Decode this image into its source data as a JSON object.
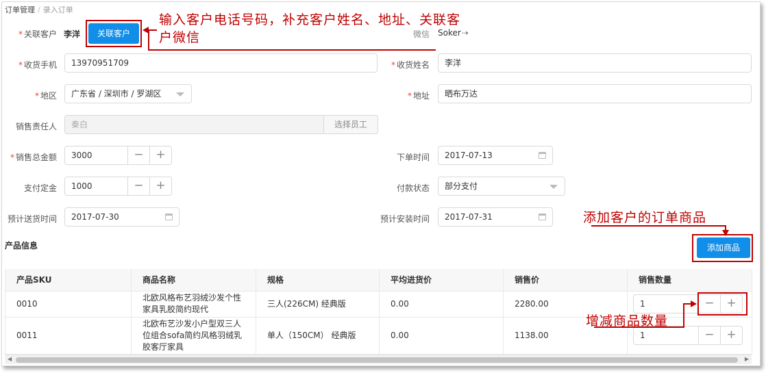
{
  "breadcrumb": {
    "parent": "订单管理",
    "separator": "/",
    "current": "录入订单"
  },
  "form": {
    "linked_customer": {
      "label": "关联客户",
      "value": "李洋",
      "button": "关联客户"
    },
    "wechat": {
      "label": "微信",
      "value": "Soker"
    },
    "phone": {
      "label": "收货手机",
      "value": "13970951709"
    },
    "name": {
      "label": "收货姓名",
      "value": "李洋"
    },
    "region": {
      "label": "地区",
      "value": "广东省 / 深圳市 / 罗湖区"
    },
    "address": {
      "label": "地址",
      "value": "晒布万达"
    },
    "sales_person": {
      "label": "销售责任人",
      "value": "秦白",
      "button": "选择员工"
    },
    "total_amount": {
      "label": "销售总金额",
      "value": "3000"
    },
    "order_time": {
      "label": "下单时间",
      "value": "2017-07-13"
    },
    "deposit": {
      "label": "支付定金",
      "value": "1000"
    },
    "payment_status": {
      "label": "付款状态",
      "value": "部分支付"
    },
    "delivery_time": {
      "label": "预计送货时间",
      "value": "2017-07-30"
    },
    "install_time": {
      "label": "预计安装时间",
      "value": "2017-07-31"
    }
  },
  "stepper": {
    "minus": "−",
    "plus": "+"
  },
  "products": {
    "title": "产品信息",
    "add_button": "添加商品",
    "columns": [
      "产品SKU",
      "商品名称",
      "规格",
      "平均进货价",
      "销售价",
      "销售数量"
    ],
    "rows": [
      {
        "sku": "0010",
        "name": "北欧风格布艺羽绒沙发个性家具乳胶简约现代",
        "spec": "三人(226CM) 经典版",
        "avg_price": "0.00",
        "price": "2280.00",
        "qty": "1"
      },
      {
        "sku": "0011",
        "name": "北欧布艺沙发小户型双三人位组合sofa简约风格羽绒乳胶客厅家具",
        "spec": "单人（150CM） 经典版",
        "avg_price": "0.00",
        "price": "1138.00",
        "qty": "1"
      }
    ]
  },
  "annotations": {
    "customer": "输入客户电话号码，补充客户姓名、地址、关联客户微信",
    "add_product": "添加客户的订单商品",
    "quantity": "增减商品数量"
  },
  "colors": {
    "primary": "#108ee9",
    "annotation": "#c00000",
    "required": "#f04134"
  }
}
